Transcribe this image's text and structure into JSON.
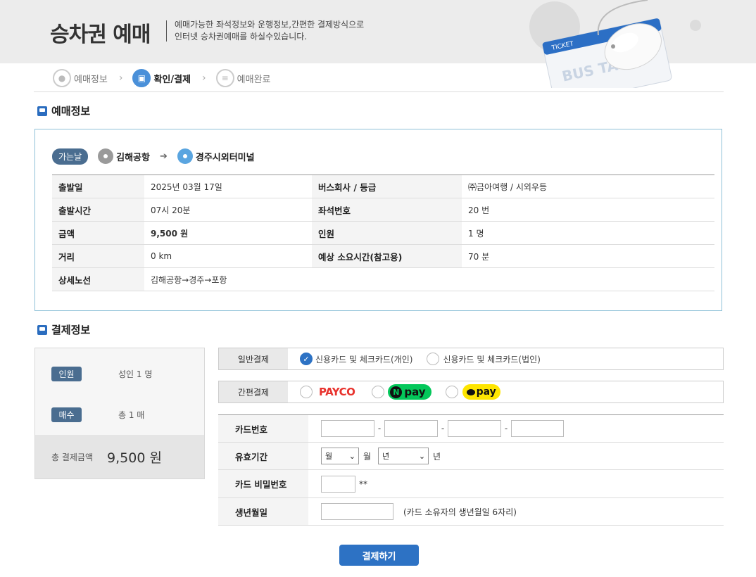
{
  "header": {
    "title": "승차권 예매",
    "desc_line1": "예매가능한 좌석정보와 운행정보,간편한 결제방식으로",
    "desc_line2": "인터넷 승차권예매를 하실수있습니다.",
    "ticket_label": "TICKET",
    "ticket_brand": "BUS TAGO"
  },
  "steps": [
    {
      "label": "예매정보",
      "active": false
    },
    {
      "label": "확인/결제",
      "active": true
    },
    {
      "label": "예매완료",
      "active": false
    }
  ],
  "reservation": {
    "section_title": "예매정보",
    "route_badge": "가는날",
    "departure": "김해공항",
    "arrival": "경주시외터미널",
    "rows": [
      {
        "h1": "출발일",
        "v1": "2025년 03월 17일",
        "h2": "버스회사 / 등급",
        "v2": "㈜금아여행 / 시외우등"
      },
      {
        "h1": "출발시간",
        "v1": "07시 20분",
        "h2": "좌석번호",
        "v2": "20 번"
      },
      {
        "h1": "금액",
        "v1": "9,500 원",
        "h2": "인원",
        "v2": "1 명"
      },
      {
        "h1": "거리",
        "v1": "0 km",
        "h2": "예상 소요시간(참고용)",
        "v2": "70 분"
      },
      {
        "h1": "상세노선",
        "v1": "김해공항→경주→포항"
      }
    ]
  },
  "payment": {
    "section_title": "결제정보",
    "summary": {
      "people_label": "인원",
      "people_value": "성인 1 명",
      "count_label": "매수",
      "count_value": "총 1 매",
      "total_label": "총 결제금액",
      "total_value": "9,500 원"
    },
    "general": {
      "label": "일반결제",
      "options": [
        {
          "label": "신용카드 및 체크카드(개인)",
          "checked": true
        },
        {
          "label": "신용카드 및 체크카드(법인)",
          "checked": false
        }
      ]
    },
    "easy": {
      "label": "간편결제",
      "payco": "PAYCO",
      "npay_n": "N",
      "npay": "pay",
      "kpay": "pay"
    },
    "card_form": {
      "card_number_label": "카드번호",
      "expiry_label": "유효기간",
      "month_select": "월",
      "month_unit": "월",
      "year_select": "년",
      "year_unit": "년",
      "password_label": "카드 비밀번호",
      "password_suffix": "**",
      "birth_label": "생년월일",
      "birth_hint": "(카드 소유자의 생년월일 6자리)"
    },
    "submit": "결제하기"
  }
}
